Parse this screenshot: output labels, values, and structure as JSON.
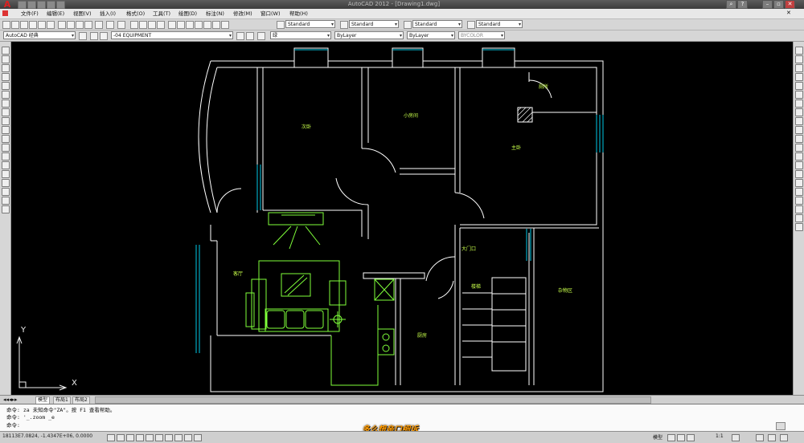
{
  "titlebar": {
    "title": "AutoCAD 2012 - [Drawing1.dwg]"
  },
  "menu": [
    "文件(F)",
    "编辑(E)",
    "视图(V)",
    "插入(I)",
    "格式(O)",
    "工具(T)",
    "绘图(D)",
    "标注(N)",
    "修改(M)",
    "窗口(W)",
    "帮助(H)"
  ],
  "toolbar1": {
    "text_style": "Standard",
    "dim_style": "Standard",
    "table_style": "Standard",
    "mleader_style": "Standard"
  },
  "toolbar2": {
    "workspace": "AutoCAD 经典",
    "layer": "-04 EQUIPMENT",
    "color": "绿",
    "linetype": "ByLayer",
    "lineweight": "ByLayer",
    "plotstyle": "BYCOLOR"
  },
  "drawing": {
    "rooms": {
      "bedroom2": "次卧",
      "study": "小房间",
      "bath": "厕所",
      "master": "主卧",
      "entrance": "大门口",
      "living": "客厅",
      "stairs": "楼梯",
      "storage": "杂物区",
      "kitchen": "厨房"
    },
    "ucs": {
      "x": "X",
      "y": "Y"
    }
  },
  "tabs": [
    "模型",
    "布局1",
    "布局2"
  ],
  "command": {
    "line1": "命令: za 未知命令\"ZA\"。按 F1 查看帮助。",
    "line2": "命令: '_.zoom _e",
    "line3": "命令:"
  },
  "watermark": "多么想亲口细诉",
  "status": {
    "coords": "18113E7.0824, -1.4347E+06, 0.0000",
    "scale": "1:1"
  },
  "colors": {
    "canvas": "#000000",
    "wall": "#ffffff",
    "furniture": "#7fff3a",
    "window": "#00c8e6",
    "label": "#c8ff4a"
  }
}
